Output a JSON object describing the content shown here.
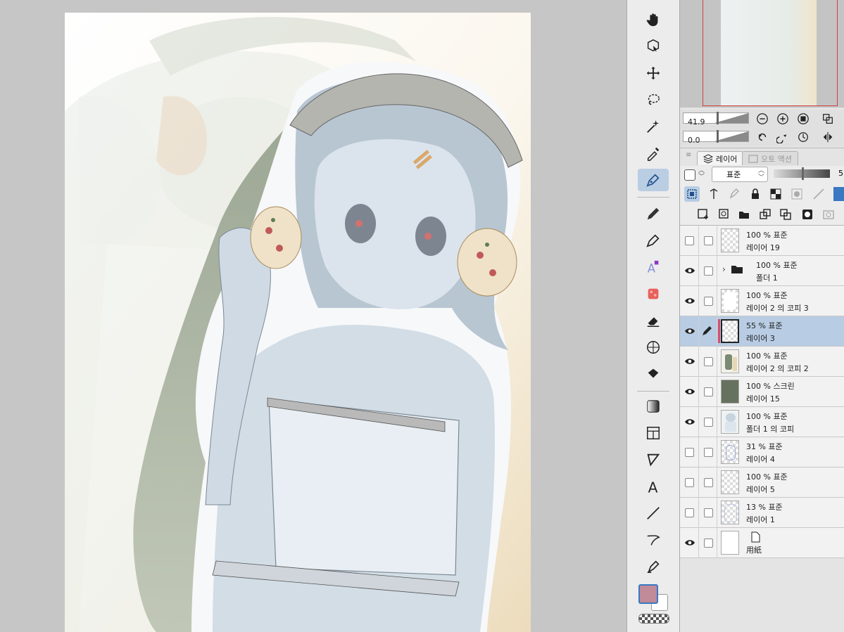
{
  "app": {
    "accent": "#3a78c2",
    "selected_row": "#b8cce3"
  },
  "canvas": {
    "background": "#c6c6c6",
    "paper": "#ffffff"
  },
  "toolbar": {
    "tools": [
      {
        "name": "hand-icon"
      },
      {
        "name": "object-select-icon"
      },
      {
        "name": "move-icon"
      },
      {
        "name": "lasso-icon"
      },
      {
        "name": "magic-wand-icon"
      },
      {
        "name": "eyedropper-icon"
      },
      {
        "name": "pen-icon",
        "active": true
      },
      {
        "name": "pencil-icon"
      },
      {
        "name": "brush-icon"
      },
      {
        "name": "airbrush-icon"
      },
      {
        "name": "decoration-icon"
      },
      {
        "name": "eraser-icon"
      },
      {
        "name": "blend-icon"
      },
      {
        "name": "fill-icon"
      },
      {
        "name": "gradient-icon"
      },
      {
        "name": "frame-icon"
      },
      {
        "name": "balloon-icon"
      },
      {
        "name": "text-icon"
      },
      {
        "name": "ruler-line-icon"
      },
      {
        "name": "correction-line-icon"
      },
      {
        "name": "sub-tool-icon"
      }
    ],
    "main_color": "#c08a98",
    "sub_color": "#ffffff"
  },
  "navigator": {
    "zoom": "41.9",
    "rotation": "0.0"
  },
  "tabs": {
    "layer": "레이어",
    "auto_action": "오토 액션"
  },
  "layer_props": {
    "blend_mode": "표준",
    "opacity_value": "5"
  },
  "layers": [
    {
      "mode": "100 % 표준",
      "name": "레이어 19",
      "visible": false,
      "thumb": "checker"
    },
    {
      "mode": "100 % 표준",
      "name": "폴더 1",
      "visible": true,
      "folder": true
    },
    {
      "mode": "100 % 표준",
      "name": "레이어 2 의 코피 3",
      "visible": true,
      "thumb": "white-shape"
    },
    {
      "mode": "55 % 표준",
      "name": "레이어 3",
      "visible": true,
      "selected": true,
      "thumb": "checker"
    },
    {
      "mode": "100 % 표준",
      "name": "레이어 2 의 코피 2",
      "visible": true,
      "thumb": "green-shape"
    },
    {
      "mode": "100 % 스크린",
      "name": "레이어 15",
      "visible": true,
      "thumb": "green-fill"
    },
    {
      "mode": "100 % 표준",
      "name": "폴더 1 의 코피",
      "visible": true,
      "thumb": "art"
    },
    {
      "mode": "31 % 표준",
      "name": "레이어 4",
      "visible": false,
      "thumb": "checker"
    },
    {
      "mode": "100 % 표준",
      "name": "레이어 5",
      "visible": false,
      "thumb": "checker"
    },
    {
      "mode": "13 % 표준",
      "name": "레이어 1",
      "visible": false,
      "thumb": "checker"
    },
    {
      "mode": "",
      "name": "用紙",
      "visible": true,
      "thumb": "paper"
    }
  ]
}
